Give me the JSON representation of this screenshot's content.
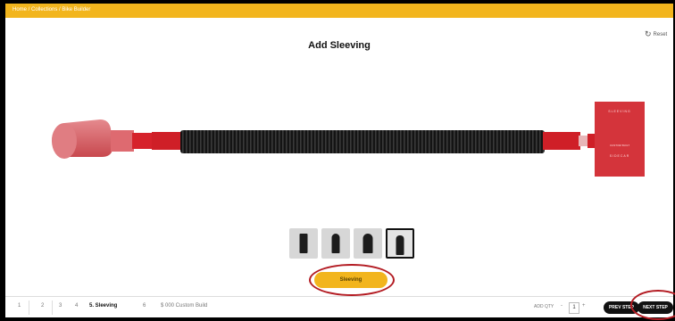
{
  "breadcrumb": "Home / Collections / Bike Builder",
  "page_title": "Add Sleeving",
  "reset_label": "Reset",
  "product": {
    "label_top": "SLEEVING",
    "label_mid": "CUSTOM BUILT",
    "label_bottom": "SIDECAR"
  },
  "sleeve_options": [
    {
      "name": "Sleeve option 1",
      "selected": false
    },
    {
      "name": "Sleeve option 2",
      "selected": false
    },
    {
      "name": "Sleeve option 3",
      "selected": false
    },
    {
      "name": "Sleeve option 4",
      "selected": true
    }
  ],
  "sleeving_button": "Sleeving",
  "steps": [
    {
      "label": "1",
      "active": false
    },
    {
      "label": "2",
      "active": false
    },
    {
      "label": "3",
      "active": false
    },
    {
      "label": "4",
      "active": false
    },
    {
      "label": "5. Sleeving",
      "active": true
    },
    {
      "label": "6",
      "active": false
    },
    {
      "label": "$ 000 Custom Build",
      "active": false
    }
  ],
  "quantity": {
    "label": "ADD QTY",
    "value": "1",
    "minus": "-",
    "plus": "+"
  },
  "prev_button": "PREV STEP",
  "next_button": "NEXT STEP",
  "colors": {
    "accent": "#f2b51d",
    "annotation": "#b31b22",
    "cable_red": "#d6222b"
  }
}
